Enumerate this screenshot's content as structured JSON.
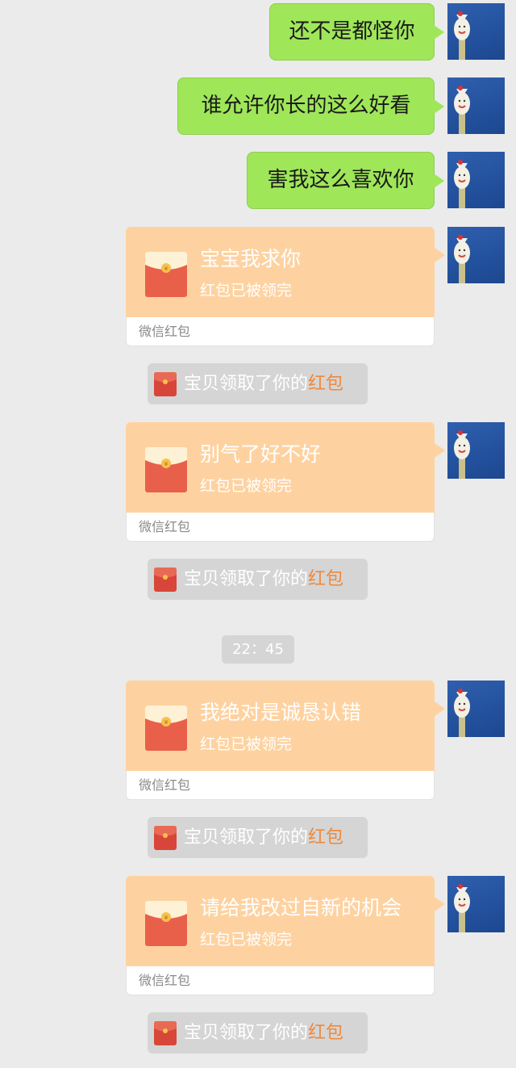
{
  "messages": [
    {
      "type": "text",
      "text": "还不是都怪你"
    },
    {
      "type": "text",
      "text": "谁允许你长的这么好看"
    },
    {
      "type": "text",
      "text": "害我这么喜欢你"
    },
    {
      "type": "red_packet",
      "title": "宝宝我求你",
      "status": "红包已被领完",
      "footer": "微信红包"
    },
    {
      "type": "notice",
      "prefix": "宝贝领取了你的",
      "link": "红包"
    },
    {
      "type": "red_packet",
      "title": "别气了好不好",
      "status": "红包已被领完",
      "footer": "微信红包"
    },
    {
      "type": "notice",
      "prefix": "宝贝领取了你的",
      "link": "红包"
    },
    {
      "type": "timestamp",
      "text": "22：45"
    },
    {
      "type": "red_packet",
      "title": "我绝对是诚恳认错",
      "status": "红包已被领完",
      "footer": "微信红包"
    },
    {
      "type": "notice",
      "prefix": "宝贝领取了你的",
      "link": "红包"
    },
    {
      "type": "red_packet",
      "title": "请给我改过自新的机会",
      "status": "红包已被领完",
      "footer": "微信红包"
    },
    {
      "type": "notice",
      "prefix": "宝贝领取了你的",
      "link": "红包"
    }
  ],
  "colors": {
    "background": "#ebebeb",
    "sent_bubble": "#9fe659",
    "packet_card": "#fed2a0",
    "notice_bg": "#d5d5d5",
    "notice_link": "#f1883a",
    "envelope_red": "#e9604a"
  },
  "icons": {
    "avatar": "swan-avatar-icon",
    "packet": "red-envelope-icon"
  }
}
